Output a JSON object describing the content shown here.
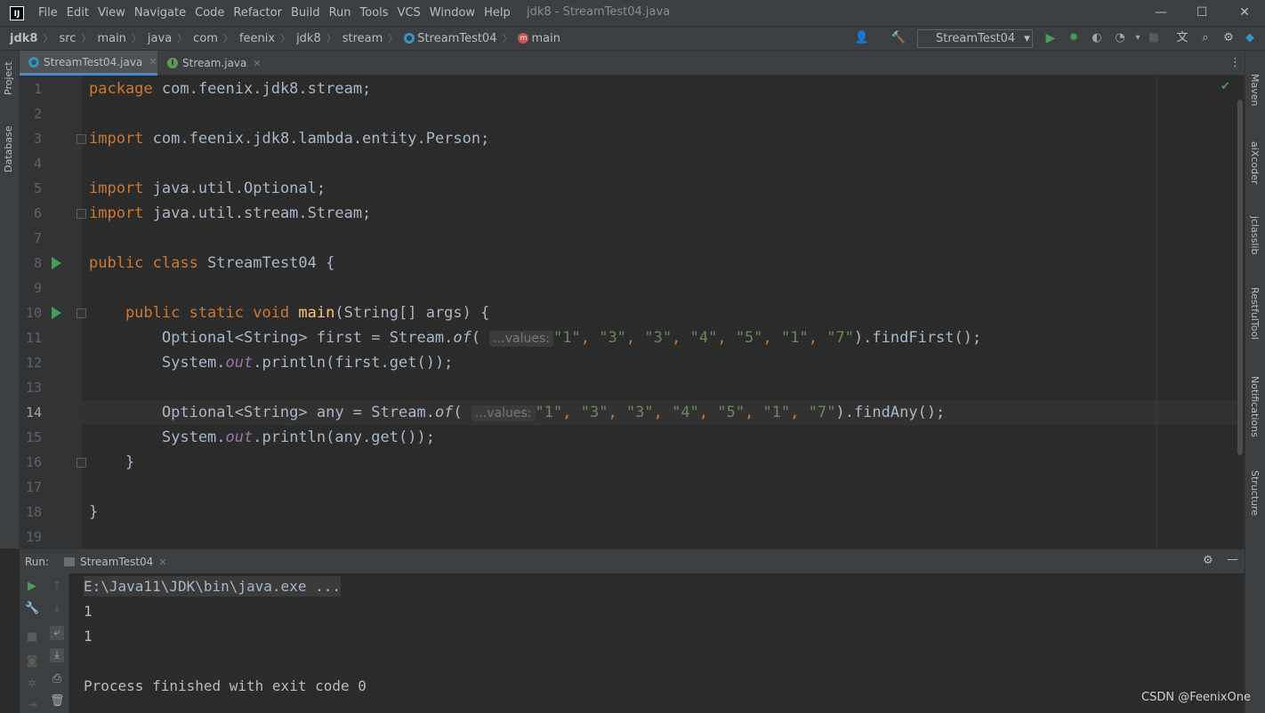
{
  "window": {
    "title": "jdk8 - StreamTest04.java",
    "logo_text": "IJ",
    "menu": [
      "File",
      "Edit",
      "View",
      "Navigate",
      "Code",
      "Refactor",
      "Build",
      "Run",
      "Tools",
      "VCS",
      "Window",
      "Help"
    ],
    "controls": {
      "minimize": "—",
      "maximize": "☐",
      "close": "✕"
    }
  },
  "breadcrumb": [
    "jdk8",
    "src",
    "main",
    "java",
    "com",
    "feenix",
    "jdk8",
    "stream",
    "StreamTest04",
    "main"
  ],
  "toolbar": {
    "run_config": "StreamTest04",
    "run_config_arrow": "▾"
  },
  "left_tool_windows": [
    "Project",
    "Database"
  ],
  "right_tool_windows": [
    "Maven",
    "aiXcoder",
    "jclasslib",
    "RestfulTool",
    "Notifications",
    "Structure"
  ],
  "editor_tabs": [
    {
      "label": "StreamTest04.java",
      "active": true,
      "icon": "class-icon"
    },
    {
      "label": "Stream.java",
      "active": false,
      "icon": "interface-icon"
    }
  ],
  "editor": {
    "line_numbers": [
      "1",
      "2",
      "3",
      "4",
      "5",
      "6",
      "7",
      "8",
      "9",
      "10",
      "11",
      "12",
      "13",
      "14",
      "15",
      "16",
      "17",
      "18",
      "19"
    ],
    "current_line": "14",
    "code": {
      "l1_kw": "package",
      "l1_rest": " com.feenix.jdk8.stream;",
      "l3_kw": "import",
      "l3_rest": " com.feenix.jdk8.lambda.entity.Person;",
      "l5_kw": "import",
      "l5_rest": " java.util.Optional;",
      "l6_kw": "import",
      "l6_rest": " java.util.stream.Stream;",
      "l8_kw": "public class",
      "l8_rest": " StreamTest04 {",
      "l10_kw": "    public static void",
      "l10_fn": " main",
      "l10_rest": "(String[] args) {",
      "l11_a": "        Optional<String> first = Stream.",
      "l11_of": "of",
      "l11_paren": "(",
      "l11_hint": "...values:",
      "l11_args": [
        "\"1\"",
        "\"3\"",
        "\"3\"",
        "\"4\"",
        "\"5\"",
        "\"1\"",
        "\"7\""
      ],
      "l11_end": ").findFirst();",
      "l12_a": "        System.",
      "l12_out": "out",
      "l12_end": ".println(first.get());",
      "l14_a": "        Optional<String> any = Stream.",
      "l14_of": "of",
      "l14_paren": "(",
      "l14_hint": "...values:",
      "l14_args": [
        "\"1\"",
        "\"3\"",
        "\"3\"",
        "\"4\"",
        "\"5\"",
        "\"1\"",
        "\"7\""
      ],
      "l14_end": ").findAny();",
      "l15_a": "        System.",
      "l15_out": "out",
      "l15_end": ".println(any.get());",
      "l16": "    }",
      "l18": "}"
    }
  },
  "run_panel": {
    "title": "Run:",
    "tab_label": "StreamTest04",
    "console": {
      "command": "E:\\Java11\\JDK\\bin\\java.exe ...",
      "output_1": "1",
      "output_2": "1",
      "finished": "Process finished with exit code 0"
    }
  },
  "watermark": "CSDN @FeenixOne",
  "colors": {
    "keyword": "#cc7832",
    "string": "#6a8759",
    "method": "#ffc66d",
    "static_field": "#9876aa",
    "run_green": "#499c54"
  }
}
